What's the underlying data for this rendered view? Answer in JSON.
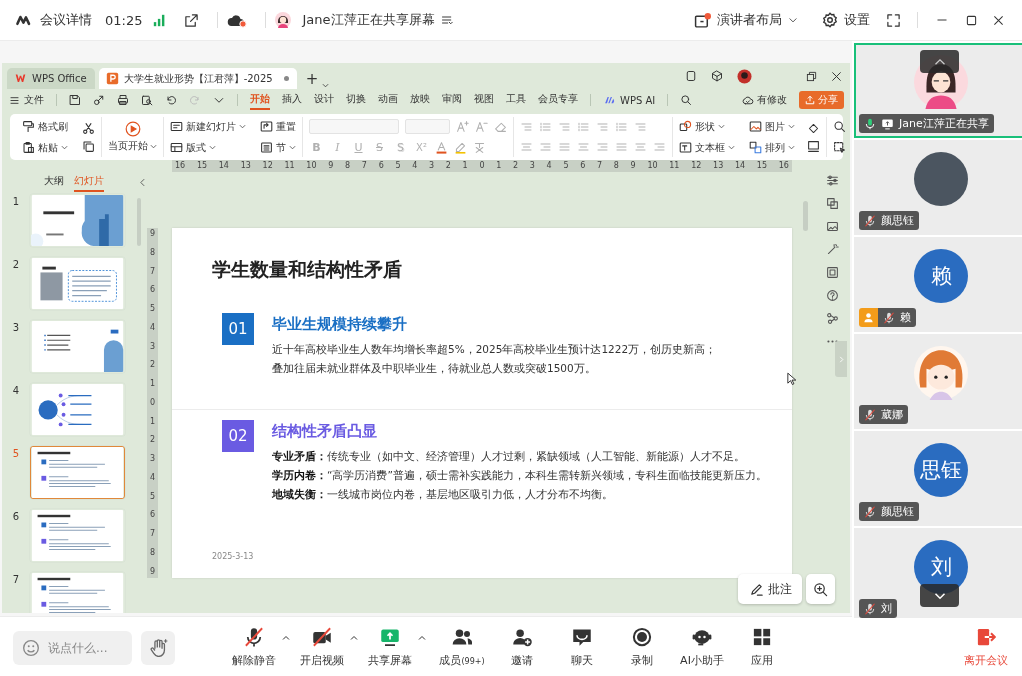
{
  "topbar": {
    "title": "会议详情",
    "timer": "01:25",
    "sharer": "Jane江萍正在共享屏幕",
    "layout": "演讲者布局",
    "settings": "设置"
  },
  "wps": {
    "tabs": [
      {
        "label": "WPS Office",
        "kind": "home",
        "selected": false
      },
      {
        "label": "大学生就业形势【江君萍】-2025",
        "kind": "document",
        "selected": true,
        "modified": true
      }
    ],
    "new_tab": "+",
    "file_menu": "文件",
    "menu": [
      {
        "label": "开始",
        "selected": true
      },
      {
        "label": "插入",
        "selected": false
      },
      {
        "label": "设计",
        "selected": false
      },
      {
        "label": "切换",
        "selected": false
      },
      {
        "label": "动画",
        "selected": false
      },
      {
        "label": "放映",
        "selected": false
      },
      {
        "label": "审阅",
        "selected": false
      },
      {
        "label": "视图",
        "selected": false
      },
      {
        "label": "工具",
        "selected": false
      },
      {
        "label": "会员专享",
        "selected": false
      }
    ],
    "ai": "WPS AI",
    "status": "有修改",
    "share": "分享",
    "ribbon": [
      {
        "kind": "clipboard",
        "disabled": false,
        "buttons": [
          {
            "label": "格式刷",
            "menu": false
          },
          {
            "label": "粘贴",
            "menu": true
          }
        ]
      },
      {
        "kind": "play",
        "disabled": false,
        "buttons": [
          {
            "label": "当页开始",
            "menu": true
          }
        ]
      },
      {
        "kind": "slides",
        "disabled": false,
        "buttons": [
          {
            "label": "新建幻灯片",
            "menu": true
          },
          {
            "label": "版式",
            "menu": true
          },
          {
            "label": "重置",
            "menu": false
          },
          {
            "label": "节",
            "menu": true
          }
        ]
      },
      {
        "kind": "font",
        "disabled": true,
        "glyphs": [
          {
            "text": "B",
            "kind": "bold"
          },
          {
            "text": "I",
            "kind": "italic"
          },
          {
            "text": "U",
            "kind": "underline"
          },
          {
            "text": "S",
            "kind": "strike"
          },
          {
            "text": "S",
            "kind": "shadow"
          },
          {
            "text": "X²",
            "kind": "superscript"
          }
        ]
      },
      {
        "kind": "paragraph",
        "disabled": true
      },
      {
        "kind": "insert",
        "disabled": false,
        "buttons": [
          {
            "label": "形状",
            "menu": true
          },
          {
            "label": "文本框",
            "menu": true
          },
          {
            "label": "图片",
            "menu": true
          },
          {
            "label": "排列",
            "menu": true
          }
        ]
      },
      {
        "kind": "find",
        "disabled": false
      }
    ],
    "ruler_h": [
      "16",
      "15",
      "14",
      "13",
      "12",
      "11",
      "10",
      "9",
      "8",
      "7",
      "6",
      "5",
      "4",
      "3",
      "2",
      "1",
      "0",
      "1",
      "2",
      "3",
      "4",
      "5",
      "6",
      "7",
      "8",
      "9",
      "10",
      "11",
      "12",
      "13",
      "14",
      "15",
      "16"
    ],
    "ruler_v": [
      "9",
      "8",
      "7",
      "6",
      "5",
      "4",
      "3",
      "2",
      "1",
      "0",
      "1",
      "2",
      "3",
      "4",
      "5",
      "6",
      "7",
      "8",
      "9"
    ],
    "panel_tabs": [
      {
        "label": "大纲",
        "selected": false
      },
      {
        "label": "幻灯片",
        "selected": true
      }
    ],
    "slides": [
      {
        "number": "1",
        "kind": "cover",
        "selected": false
      },
      {
        "number": "2",
        "kind": "profile",
        "selected": false
      },
      {
        "number": "3",
        "kind": "list",
        "selected": false
      },
      {
        "number": "4",
        "kind": "diagram",
        "selected": false
      },
      {
        "number": "5",
        "kind": "text",
        "selected": true
      },
      {
        "number": "6",
        "kind": "text",
        "selected": false
      },
      {
        "number": "7",
        "kind": "text",
        "selected": false
      }
    ],
    "slide": {
      "title": "学生数量和结构性矛盾",
      "sections": [
        {
          "number": "01",
          "heading": "毕业生规模持续攀升",
          "color": "#1a6fc4",
          "lines": [
            "近十年高校毕业生人数年均增长率超5%，2025年高校毕业生预计达1222万，创历史新高；",
            "叠加往届未就业群体及中职毕业生，待就业总人数或突破1500万。"
          ]
        },
        {
          "number": "02",
          "heading": "结构性矛盾凸显",
          "color": "#6a5be2",
          "lines": [
            "**专业矛盾：**传统专业（如中文、经济管理）人才过剩，紧缺领域（人工智能、新能源）人才不足。",
            "**学历内卷：**“高学历消费”普遍，硕士需补实践能力，本科生需转新兴领域，专科生面临技能更新压力。",
            "**地域失衡：**一线城市岗位内卷，基层地区吸引力低，人才分布不均衡。"
          ]
        }
      ],
      "date": "2025-3-13"
    },
    "comment_button": "批注"
  },
  "participants": [
    {
      "label": "Jane江萍正在共享",
      "kind": "cartoon_woman",
      "muted": false,
      "sharing": true,
      "host": false,
      "selected": true
    },
    {
      "label": "颜思钰",
      "kind": "photo",
      "muted": true,
      "sharing": false,
      "host": false,
      "selected": false
    },
    {
      "label": "赖",
      "kind": "initials",
      "initials": "赖",
      "muted": true,
      "sharing": false,
      "host": true,
      "selected": false
    },
    {
      "label": "葳娜",
      "kind": "cartoon_girl",
      "muted": true,
      "sharing": false,
      "host": false,
      "selected": false
    },
    {
      "label": "颜思钰",
      "kind": "initials",
      "initials": "思钰",
      "muted": true,
      "sharing": false,
      "host": false,
      "selected": false
    },
    {
      "label": "刘",
      "kind": "initials",
      "initials": "刘",
      "muted": true,
      "sharing": false,
      "host": false,
      "selected": false
    }
  ],
  "toolbar": {
    "chat_placeholder": "说点什么...",
    "controls": [
      {
        "kind": "mic",
        "label": "解除静音",
        "menu": true,
        "off": true
      },
      {
        "kind": "camera",
        "label": "开启视频",
        "menu": true,
        "off": true
      },
      {
        "kind": "share",
        "label": "共享屏幕",
        "menu": true,
        "off": false
      },
      {
        "kind": "members",
        "label": "成员",
        "count": "(99+)",
        "menu": false,
        "off": false
      },
      {
        "kind": "invite",
        "label": "邀请",
        "menu": false,
        "off": false
      },
      {
        "kind": "chat",
        "label": "聊天",
        "menu": false,
        "off": false
      },
      {
        "kind": "record",
        "label": "录制",
        "menu": false,
        "off": false
      },
      {
        "kind": "assistant",
        "label": "AI小助手",
        "menu": false,
        "off": false
      },
      {
        "kind": "apps",
        "label": "应用",
        "menu": false,
        "off": false
      }
    ],
    "leave": "离开会议"
  }
}
